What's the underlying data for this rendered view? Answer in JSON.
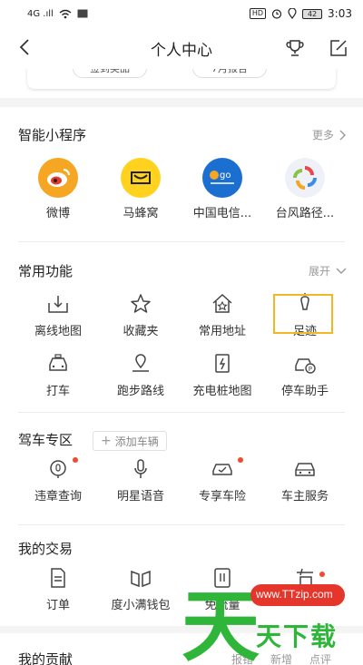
{
  "status_bar": {
    "left": "4G .ıll",
    "badge_hd": "HD",
    "battery": "42",
    "time": "3:03"
  },
  "nav": {
    "title": "个人中心"
  },
  "top_card": {
    "pill_left": "签到奖品",
    "pill_right": "7月报告"
  },
  "mini_programs": {
    "title": "智能小程序",
    "more": "更多",
    "items": [
      {
        "label": "微博",
        "icon": "weibo-icon",
        "color": "#f5a623"
      },
      {
        "label": "马蜂窝",
        "icon": "mafengwo-icon",
        "color": "#ffd21f"
      },
      {
        "label": "中国电信...",
        "icon": "china-telecom-icon",
        "color": "#1b6fd1"
      },
      {
        "label": "台风路径...",
        "icon": "typhoon-icon",
        "color": "#e9eef6"
      }
    ]
  },
  "common": {
    "title": "常用功能",
    "expand": "展开",
    "row1": [
      {
        "label": "离线地图",
        "icon": "offline-map-icon"
      },
      {
        "label": "收藏夹",
        "icon": "star-icon"
      },
      {
        "label": "常用地址",
        "icon": "home-star-icon"
      },
      {
        "label": "足迹",
        "icon": "footprint-icon"
      }
    ],
    "row2": [
      {
        "label": "打车",
        "icon": "taxi-icon"
      },
      {
        "label": "跑步路线",
        "icon": "running-route-icon"
      },
      {
        "label": "充电桩地图",
        "icon": "charging-pile-icon"
      },
      {
        "label": "停车助手",
        "icon": "parking-icon"
      }
    ]
  },
  "driving": {
    "title": "驾车专区",
    "add_car": "添加车辆",
    "items": [
      {
        "label": "违章查询",
        "icon": "violation-icon",
        "dot": true
      },
      {
        "label": "明星语音",
        "icon": "microphone-icon",
        "dot": false
      },
      {
        "label": "专享车险",
        "icon": "car-insurance-icon",
        "dot": true
      },
      {
        "label": "车主服务",
        "icon": "car-service-icon",
        "dot": false
      }
    ]
  },
  "trade": {
    "title": "我的交易",
    "items": [
      {
        "label": "订单",
        "icon": "order-icon",
        "dot": false
      },
      {
        "label": "度小满钱包",
        "icon": "wallet-icon",
        "dot": false
      },
      {
        "label": "免流量",
        "icon": "data-free-icon",
        "dot": false
      },
      {
        "label": "",
        "icon": "coupon-icon",
        "dot": true
      }
    ]
  },
  "contrib": {
    "title": "我的贡献",
    "links": [
      "报错",
      "新增",
      "点评"
    ]
  },
  "watermark": {
    "url": "www.TTzip.com",
    "brand": "天下载",
    "logo_char": "天"
  },
  "colors": {
    "accent_yellow": "#f2b823",
    "red_dot": "#f04a32",
    "watermark_green": "#2fb63a",
    "watermark_red": "#e4362b"
  }
}
